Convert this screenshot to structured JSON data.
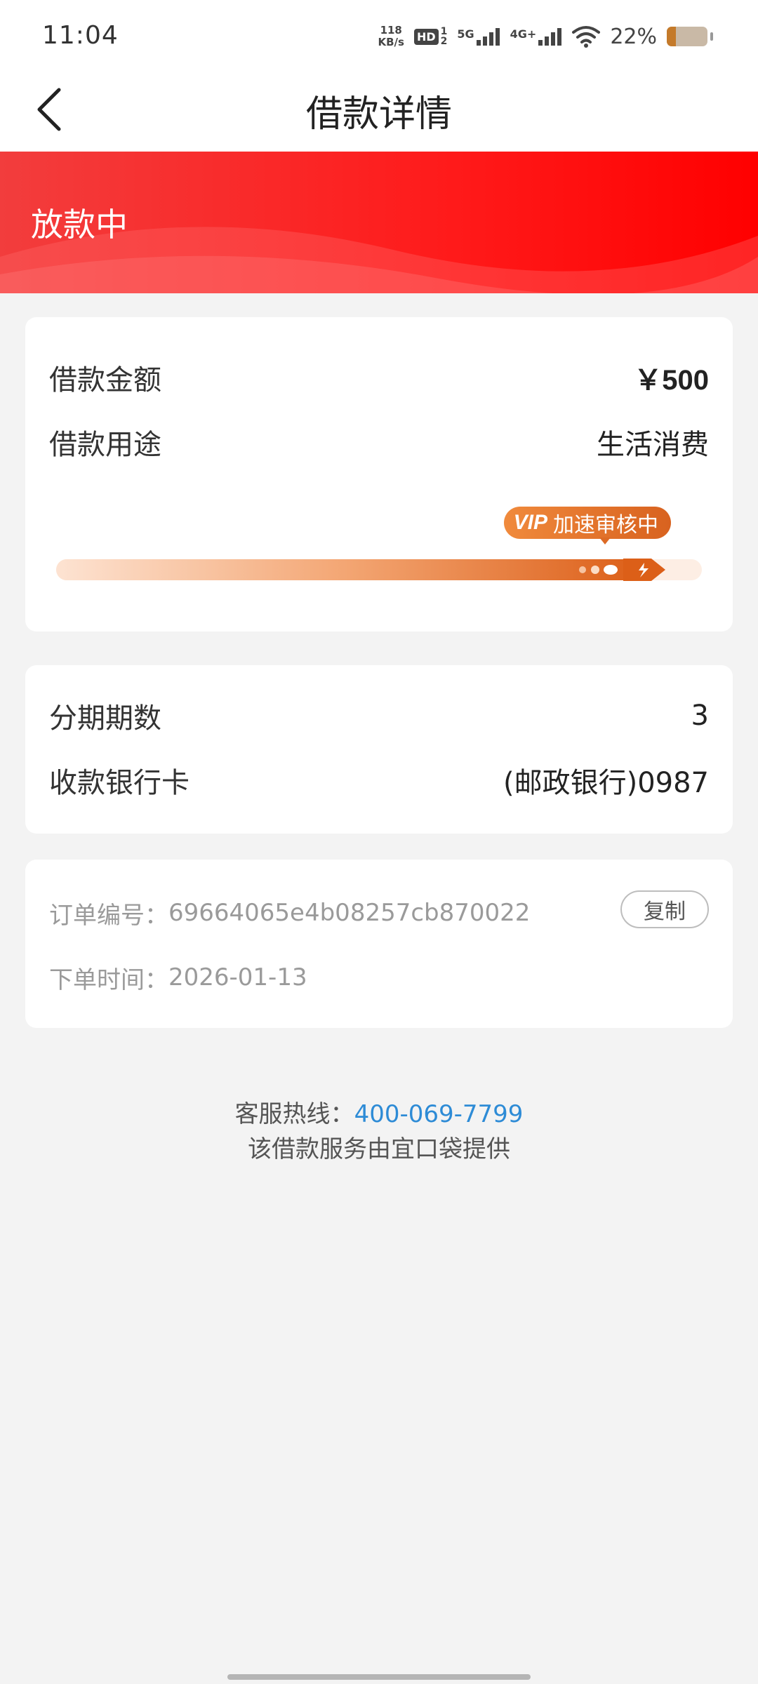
{
  "status_bar": {
    "time": "11:04",
    "net_speed_value": "118",
    "net_speed_unit": "KB/s",
    "hd_label": "HD",
    "hd_sub_top": "1",
    "hd_sub_bottom": "2",
    "network_1": "5G",
    "network_2": "4G+",
    "battery_percent": "22%",
    "battery_level": 0.22,
    "icons": [
      "wifi-icon",
      "signal-icon",
      "battery-icon"
    ]
  },
  "nav": {
    "title": "借款详情",
    "back_icon": "chevron-left-icon"
  },
  "banner": {
    "status": "放款中",
    "color": "#ff1a1a"
  },
  "loan_card": {
    "amount_label": "借款金额",
    "amount_value": "￥500",
    "purpose_label": "借款用途",
    "purpose_value": "生活消费",
    "vip_tag": "VIP",
    "vip_text": "加速审核中",
    "progress": 0.95,
    "accent": "#e2691f"
  },
  "installment_card": {
    "periods_label": "分期期数",
    "periods_value": "3",
    "bank_label": "收款银行卡",
    "bank_value": "(邮政银行)0987"
  },
  "order_card": {
    "order_no_label": "订单编号：",
    "order_no_value": "69664065e4b08257cb870022",
    "copy_label": "复制",
    "order_time_label": "下单时间：",
    "order_time_value": "2026-01-13"
  },
  "footer": {
    "hotline_label": "客服热线：",
    "hotline_number": "400-069-7799",
    "provider_text": "该借款服务由宜口袋提供",
    "link_color": "#2d8bd6"
  }
}
